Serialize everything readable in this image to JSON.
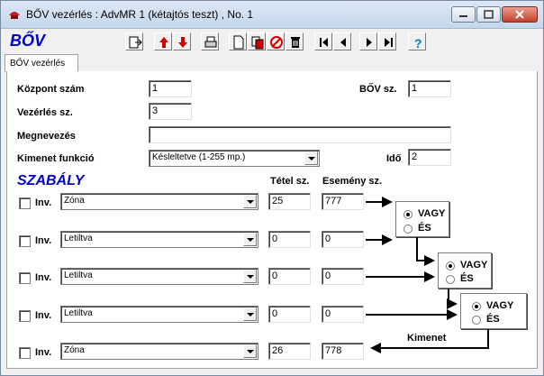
{
  "window": {
    "title": "BŐV vezérlés : AdvMR 1 (kétajtós teszt) , No. 1"
  },
  "toolbar": {
    "logo": "BŐV"
  },
  "tabs": [
    {
      "label": "BŐV vezérlés"
    }
  ],
  "form": {
    "kozpont": {
      "label": "Központ szám",
      "value": "1"
    },
    "bov": {
      "label": "BŐV sz.",
      "value": "1"
    },
    "vezerles": {
      "label": "Vezérlés sz.",
      "value": "3"
    },
    "megnevezes": {
      "label": "Megnevezés",
      "value": ""
    },
    "kimenet": {
      "label": "Kimenet funkció",
      "value": "Késleltetve (1-255 mp.)"
    },
    "ido": {
      "label": "Idő",
      "value": "2"
    }
  },
  "szabaly": {
    "title": "SZABÁLY",
    "col_tetel": "Tétel sz.",
    "col_esemeny": "Esemény sz.",
    "inv_label": "Inv.",
    "rows": [
      {
        "type": "Zóna",
        "tetel": "25",
        "esemeny": "777"
      },
      {
        "type": "Letiltva",
        "tetel": "0",
        "esemeny": "0"
      },
      {
        "type": "Letiltva",
        "tetel": "0",
        "esemeny": "0"
      },
      {
        "type": "Letiltva",
        "tetel": "0",
        "esemeny": "0"
      },
      {
        "type": "Zóna",
        "tetel": "26",
        "esemeny": "778"
      }
    ],
    "vagy": "VAGY",
    "es": "ÉS",
    "kimenet_label": "Kimenet"
  }
}
